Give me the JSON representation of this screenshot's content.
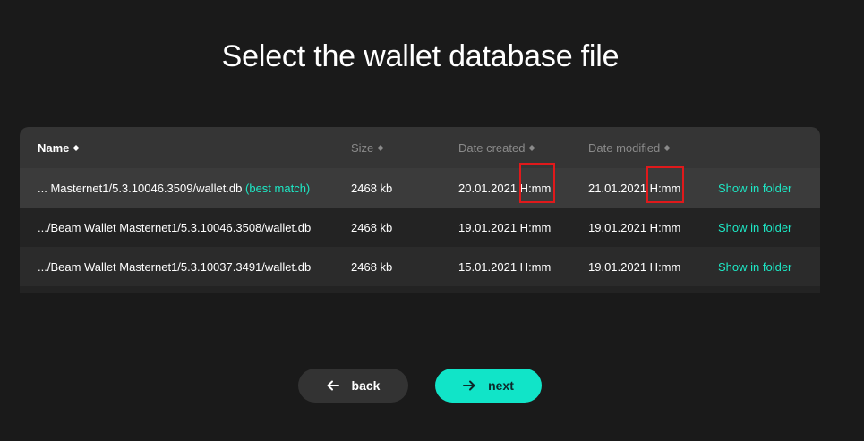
{
  "title": "Select the wallet database file",
  "table": {
    "columns": {
      "name": "Name",
      "size": "Size",
      "created": "Date created",
      "modified": "Date modified"
    },
    "rows": [
      {
        "name": "... Masternet1/5.3.10046.3509/wallet.db",
        "badge": "(best match)",
        "size": "2468 kb",
        "created": "20.01.2021 H:mm",
        "modified": "21.01.2021 H:mm",
        "action": "Show in folder"
      },
      {
        "name": ".../Beam Wallet Masternet1/5.3.10046.3508/wallet.db",
        "badge": "",
        "size": "2468 kb",
        "created": "19.01.2021 H:mm",
        "modified": "19.01.2021 H:mm",
        "action": "Show in folder"
      },
      {
        "name": ".../Beam Wallet Masternet1/5.3.10037.3491/wallet.db",
        "badge": "",
        "size": "2468 kb",
        "created": "15.01.2021 H:mm",
        "modified": "19.01.2021 H:mm",
        "action": "Show in folder"
      }
    ]
  },
  "buttons": {
    "back": "back",
    "next": "next"
  },
  "colors": {
    "background": "#1a1a1a",
    "accent": "#11e4c8",
    "highlight": "#e0191b"
  },
  "icons": {
    "sort": "sort-icon",
    "back": "arrow-left-icon",
    "next": "arrow-right-icon"
  }
}
